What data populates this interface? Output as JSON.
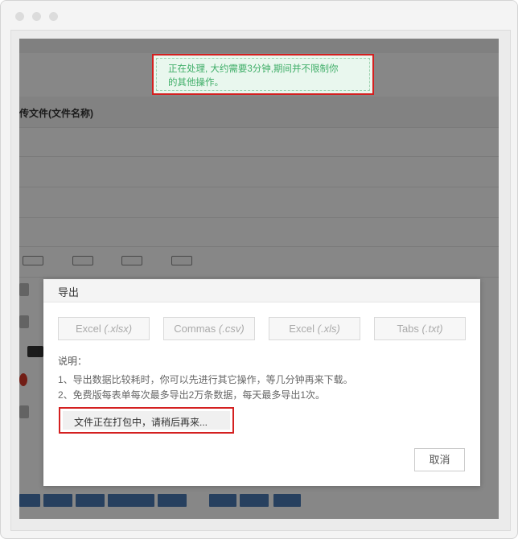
{
  "toast": {
    "line1": "正在处理, 大约需要3分钟,期间并不限制你",
    "line2": "的其他操作。"
  },
  "background": {
    "column_header": "传文件(文件名称)"
  },
  "dialog": {
    "title": "导出",
    "buttons": [
      {
        "name": "Excel",
        "ext": "(.xlsx)"
      },
      {
        "name": "Commas",
        "ext": "(.csv)"
      },
      {
        "name": "Excel",
        "ext": "(.xls)"
      },
      {
        "name": "Tabs",
        "ext": "(.txt)"
      }
    ],
    "desc_title": "说明：",
    "desc_lines": [
      "1、导出数据比较耗时，你可以先进行其它操作，等几分钟再来下载。",
      "2、免费版每表单每次最多导出2万条数据，每天最多导出1次。"
    ],
    "packing_message": "文件正在打包中，请稍后再来...",
    "cancel_label": "取消"
  },
  "colors": {
    "highlight_border": "#d42020",
    "toast_text": "#3fae68",
    "toast_bg": "#e9f7ee"
  }
}
